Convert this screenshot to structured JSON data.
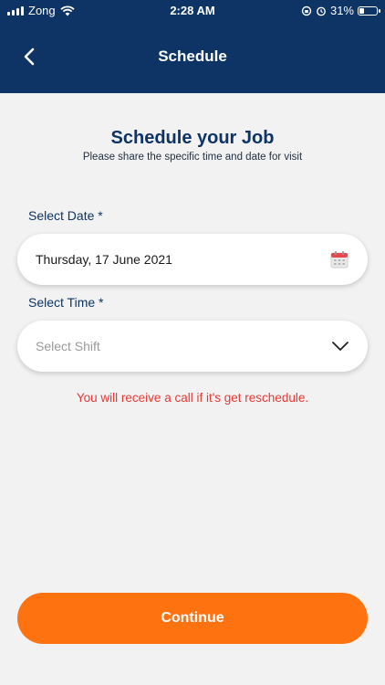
{
  "status_bar": {
    "carrier": "Zong",
    "time": "2:28 AM",
    "battery_percent": "31%",
    "battery_level": 0.31
  },
  "header": {
    "title": "Schedule",
    "back_icon": "chevron-left-icon"
  },
  "intro": {
    "heading": "Schedule your Job",
    "subheading": "Please share the specific time and date for visit"
  },
  "date_field": {
    "label": "Select Date *",
    "value": "Thursday, 17 June 2021",
    "icon": "calendar-icon"
  },
  "time_field": {
    "label": "Select Time *",
    "placeholder": "Select Shift",
    "icon": "chevron-down-icon"
  },
  "notice": "You will receive a call if it's get reschedule.",
  "continue_label": "Continue",
  "colors": {
    "header_bg": "#0d3464",
    "accent": "#ff7210",
    "notice": "#e53935",
    "background": "#f2f2f2"
  }
}
